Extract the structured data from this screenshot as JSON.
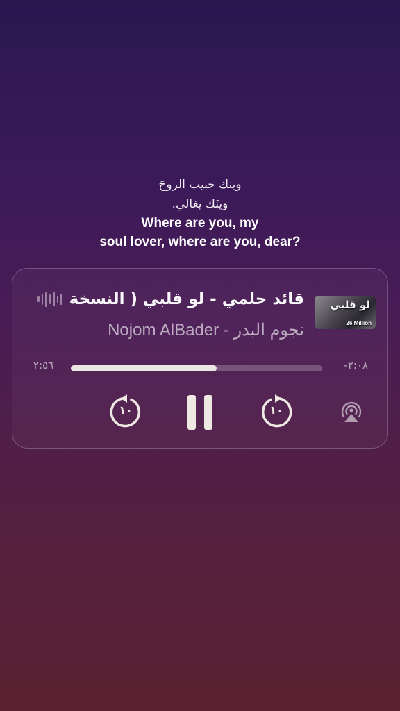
{
  "lyrics": {
    "line1_ar": "وينك حبيب الروحَ",
    "line2_ar": "وينَك يغالي.",
    "line3_en": "Where are you, my",
    "line4_en": "soul lover, where are you, dear?"
  },
  "player": {
    "title": "قائد حلمي - لو قلبي ( النسخة",
    "artist": "Nojom AlBader - نجوم البدر",
    "artwork": {
      "title_text": "لو قلبي",
      "caption": "26 Million"
    },
    "time_elapsed": "٢:٥٦",
    "time_remaining": "-٢:٠٨",
    "progress": 0.58,
    "skip_back_label": "١٠",
    "skip_forward_label": "١٠",
    "icons": {
      "skip_back": "skip-back-10-icon",
      "play_pause": "pause-icon",
      "skip_forward": "skip-forward-10-icon",
      "airplay": "airplay-icon",
      "waveform": "waveform-icon"
    },
    "colors": {
      "accent": "#ece6e2",
      "track": "rgba(255,255,255,0.22)"
    }
  }
}
